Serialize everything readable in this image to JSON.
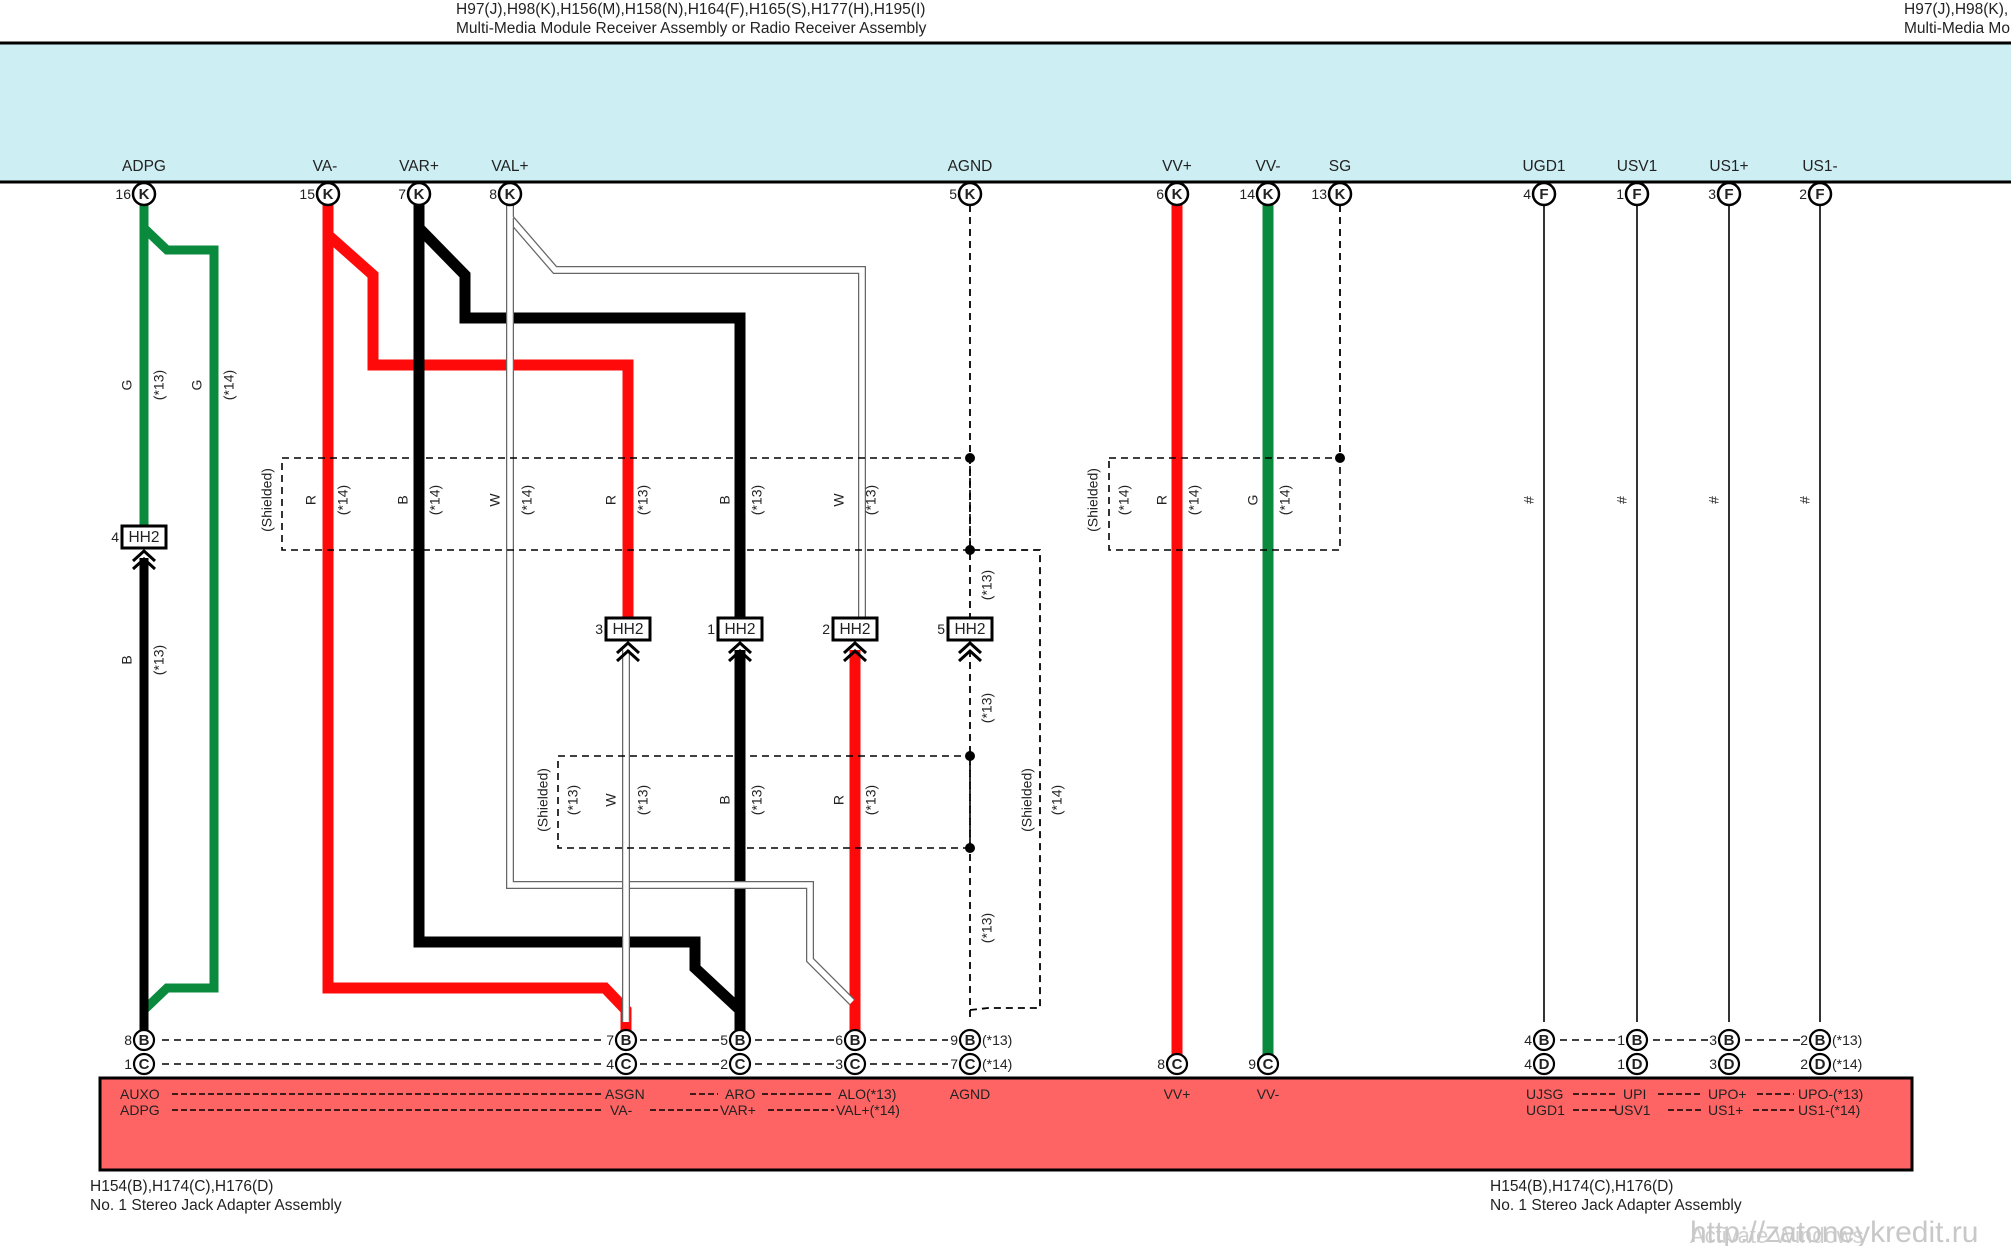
{
  "top_connector": {
    "codes_left": "H97(J),H98(K),H156(M),H158(N),H164(F),H165(S),H177(H),H195(I)",
    "name_left": "Multi-Media Module Receiver Assembly or Radio Receiver Assembly",
    "codes_right": "H97(J),H98(K),",
    "name_right": "Multi-Media Mo",
    "color": "#cdeef3"
  },
  "bottom_connector": {
    "codes_left": "H154(B),H174(C),H176(D)",
    "name_left": "No. 1 Stereo Jack Adapter Assembly",
    "codes_right": "H154(B),H174(C),H176(D)",
    "name_right": "No. 1 Stereo Jack Adapter Assembly",
    "color": "#ff6464"
  },
  "top_pins": [
    {
      "id": "adpg",
      "label": "ADPG",
      "num": "16",
      "letter": "K"
    },
    {
      "id": "va-minus",
      "label": "VA-",
      "num": "15",
      "letter": "K"
    },
    {
      "id": "var-plus",
      "label": "VAR+",
      "num": "7",
      "letter": "K"
    },
    {
      "id": "val-plus",
      "label": "VAL+",
      "num": "8",
      "letter": "K"
    },
    {
      "id": "agnd",
      "label": "AGND",
      "num": "5",
      "letter": "K"
    },
    {
      "id": "vv-plus",
      "label": "VV+",
      "num": "6",
      "letter": "K"
    },
    {
      "id": "vv-minus",
      "label": "VV-",
      "num": "14",
      "letter": "K"
    },
    {
      "id": "sg",
      "label": "SG",
      "num": "13",
      "letter": "K"
    },
    {
      "id": "ugd1",
      "label": "UGD1",
      "num": "4",
      "letter": "F"
    },
    {
      "id": "usv1",
      "label": "USV1",
      "num": "1",
      "letter": "F"
    },
    {
      "id": "us1-plus",
      "label": "US1+",
      "num": "3",
      "letter": "F"
    },
    {
      "id": "us1-minus",
      "label": "US1-",
      "num": "2",
      "letter": "F"
    }
  ],
  "bottom_pins_row1": [
    {
      "id": "b-adpg",
      "num": "8",
      "letter": "B",
      "suffix": ""
    },
    {
      "id": "b-asgn",
      "num": "7",
      "letter": "B",
      "suffix": ""
    },
    {
      "id": "b-aro",
      "num": "5",
      "letter": "B",
      "suffix": ""
    },
    {
      "id": "b-alo",
      "num": "6",
      "letter": "B",
      "suffix": ""
    },
    {
      "id": "b-agnd",
      "num": "9",
      "letter": "B",
      "suffix": "(*13)"
    },
    {
      "id": "b-ujsg",
      "num": "4",
      "letter": "B",
      "suffix": ""
    },
    {
      "id": "b-upi",
      "num": "1",
      "letter": "B",
      "suffix": ""
    },
    {
      "id": "b-upo-plus",
      "num": "3",
      "letter": "B",
      "suffix": ""
    },
    {
      "id": "b-upo-minus",
      "num": "2",
      "letter": "B",
      "suffix": "(*13)"
    }
  ],
  "bottom_pins_row2": [
    {
      "id": "c-adpg",
      "num": "1",
      "letter": "C",
      "suffix": ""
    },
    {
      "id": "c-va",
      "num": "4",
      "letter": "C",
      "suffix": ""
    },
    {
      "id": "c-var",
      "num": "2",
      "letter": "C",
      "suffix": ""
    },
    {
      "id": "c-val",
      "num": "3",
      "letter": "C",
      "suffix": ""
    },
    {
      "id": "c-agnd",
      "num": "7",
      "letter": "C",
      "suffix": "(*14)"
    },
    {
      "id": "c-vvp",
      "num": "8",
      "letter": "C",
      "suffix": ""
    },
    {
      "id": "c-vvm",
      "num": "9",
      "letter": "C",
      "suffix": ""
    },
    {
      "id": "d-ugd1",
      "num": "4",
      "letter": "D",
      "suffix": ""
    },
    {
      "id": "d-usv1",
      "num": "1",
      "letter": "D",
      "suffix": ""
    },
    {
      "id": "d-us1p",
      "num": "3",
      "letter": "D",
      "suffix": ""
    },
    {
      "id": "d-us1m",
      "num": "2",
      "letter": "D",
      "suffix": "(*14)"
    }
  ],
  "bottom_labels": [
    {
      "id": "auxo",
      "text": "AUXO"
    },
    {
      "id": "adpg2",
      "text": "ADPG"
    },
    {
      "id": "asgn",
      "text": "ASGN"
    },
    {
      "id": "va2",
      "text": "VA-"
    },
    {
      "id": "aro",
      "text": "ARO"
    },
    {
      "id": "var2",
      "text": "VAR+"
    },
    {
      "id": "alo",
      "text": "ALO(*13)"
    },
    {
      "id": "val2",
      "text": "VAL+(*14)"
    },
    {
      "id": "agnd2",
      "text": "AGND"
    },
    {
      "id": "vvp2",
      "text": "VV+"
    },
    {
      "id": "vvm2",
      "text": "VV-"
    },
    {
      "id": "ujsg",
      "text": "UJSG"
    },
    {
      "id": "ugd12",
      "text": "UGD1"
    },
    {
      "id": "upi",
      "text": "UPI"
    },
    {
      "id": "usv12",
      "text": "USV1"
    },
    {
      "id": "upop",
      "text": "UPO+"
    },
    {
      "id": "us1p2",
      "text": "US1+"
    },
    {
      "id": "upom",
      "text": "UPO-(*13)"
    },
    {
      "id": "us1m2",
      "text": "US1-(*14)"
    }
  ],
  "junctions": [
    {
      "id": "hh2-4",
      "num": "4",
      "code": "HH2"
    },
    {
      "id": "hh2-3",
      "num": "3",
      "code": "HH2"
    },
    {
      "id": "hh2-1",
      "num": "1",
      "code": "HH2"
    },
    {
      "id": "hh2-2",
      "num": "2",
      "code": "HH2"
    },
    {
      "id": "hh2-5",
      "num": "5",
      "code": "HH2"
    }
  ],
  "wire_colors": {
    "green": "#0a8a3c",
    "red": "#ff0a0a",
    "black": "#000000",
    "white": "#ffffff"
  },
  "wire_labels": {
    "g": "G",
    "r": "R",
    "b": "B",
    "w": "W",
    "hash": "#",
    "note13": "(*13)",
    "note14": "(*14)",
    "shielded": "(Shielded)"
  },
  "watermark": {
    "url": "http://zatoneykredit.ru",
    "activate": "Activate Windows"
  }
}
